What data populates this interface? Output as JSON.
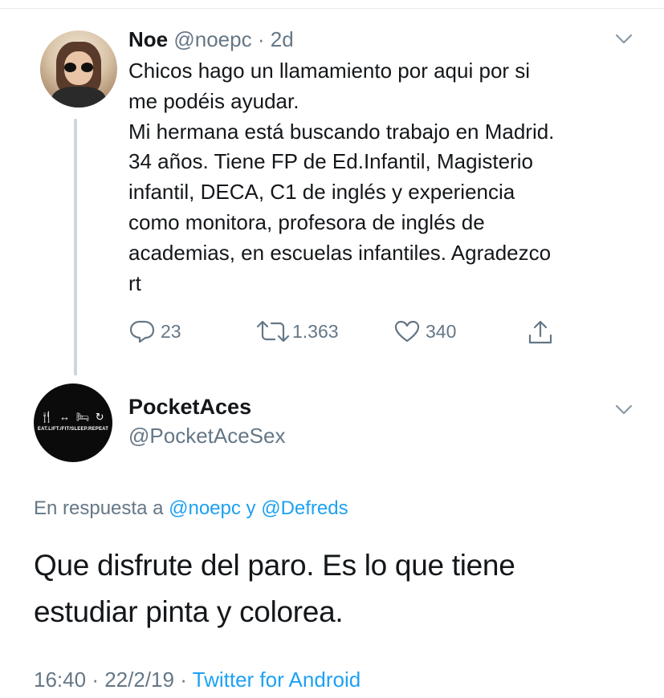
{
  "tweet1": {
    "name": "Noe",
    "handle": "@noepc",
    "separator": "·",
    "age": "2d",
    "lines": [
      "Chicos hago un llamamiento por aqui por si",
      "me podéis ayudar.",
      "Mi hermana está buscando trabajo en Madrid.",
      "34 años. Tiene FP de Ed.Infantil, Magisterio",
      "infantil, DECA, C1 de inglés y experiencia",
      "como monitora, profesora de inglés de",
      "academias, en escuelas infantiles. Agradezco",
      "rt"
    ],
    "actions": {
      "replies": "23",
      "retweets": "1.363",
      "likes": "340"
    },
    "icons": [
      "chevron-down-icon",
      "reply-icon",
      "retweet-icon",
      "like-icon",
      "share-icon"
    ]
  },
  "tweet2": {
    "name": "PocketAces",
    "handle": "@PocketAceSex",
    "avatar_text": "EAT.LIFT./FIT/SLEEP.REPEAT",
    "avatar_icons": "🍴 ↔ 🛏 ↻",
    "reply_prefix": "En respuesta a",
    "reply_mention1": "@noepc",
    "reply_and": "y",
    "reply_mention2": "@Defreds",
    "lines": [
      "Que disfrute del paro. Es lo que tiene",
      "estudiar pinta y colorea."
    ],
    "time": "16:40",
    "separator": "·",
    "date": "22/2/19",
    "source": "Twitter for Android"
  },
  "colors": {
    "text": "#14171a",
    "secondary": "#657786",
    "link": "#1da1f2",
    "divider": "#e6ecf0",
    "thread_line": "#ccd6dd"
  }
}
